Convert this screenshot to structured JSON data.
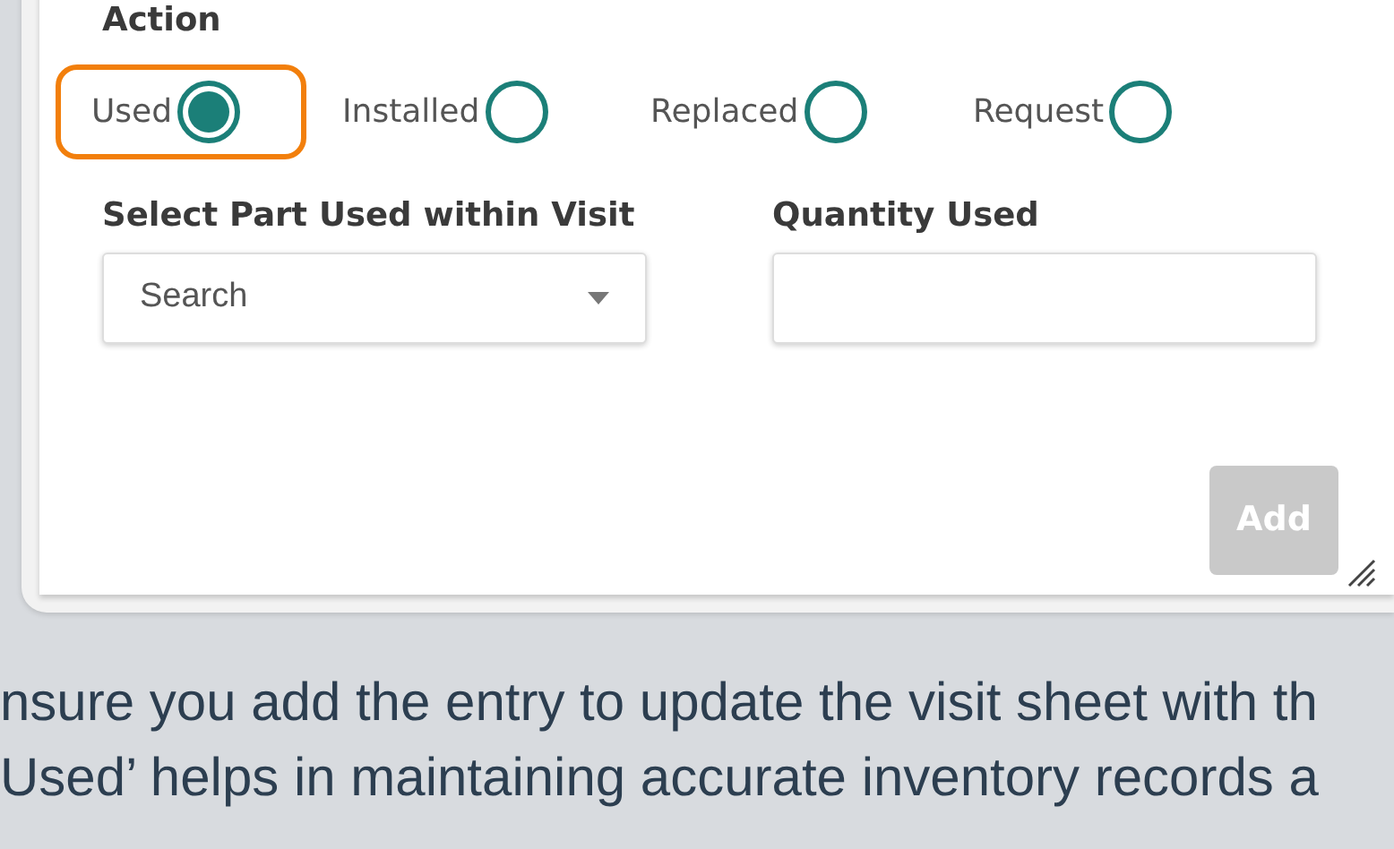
{
  "dialog": {
    "action_label": "Action",
    "actions": [
      {
        "label": "Used",
        "selected": true,
        "highlighted": true
      },
      {
        "label": "Installed",
        "selected": false,
        "highlighted": false
      },
      {
        "label": "Replaced",
        "selected": false,
        "highlighted": false
      },
      {
        "label": "Request",
        "selected": false,
        "highlighted": false
      }
    ],
    "part_label": "Select Part Used within Visit",
    "part_select": {
      "placeholder": "Search"
    },
    "quantity_label": "Quantity Used",
    "add_button": {
      "label": "Add",
      "disabled": true
    }
  },
  "body_text": [
    "nsure you add the entry to update the visit sheet with th",
    "Used’ helps in maintaining accurate inventory records a"
  ]
}
